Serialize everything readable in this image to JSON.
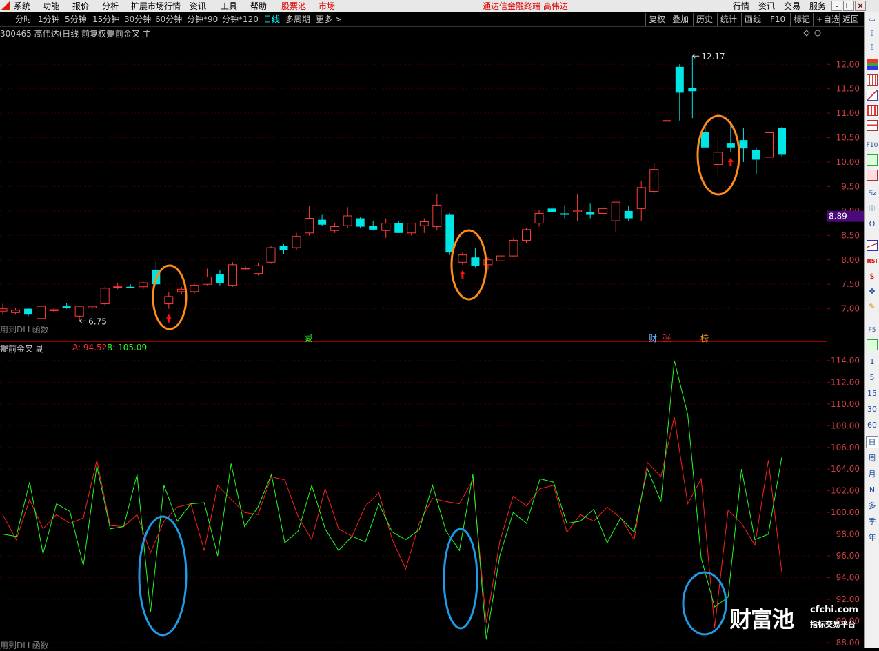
{
  "menu": {
    "items": [
      "系统",
      "功能",
      "报价",
      "分析",
      "扩展市场行情",
      "资讯",
      "工具",
      "帮助"
    ],
    "pool_label": "股票池",
    "market_label": "市场",
    "title": "通达信金融终端  高伟达",
    "right_items": [
      "行情",
      "资讯",
      "交易",
      "服务"
    ]
  },
  "periods": {
    "items": [
      "分时",
      "1分钟",
      "5分钟",
      "15分钟",
      "30分钟",
      "60分钟",
      "分钟*90",
      "分钟*120",
      "日线",
      "多周期",
      "更多 >"
    ],
    "active": "日线"
  },
  "tools": [
    "复权",
    "叠加",
    "历史",
    "统计",
    "画线",
    "F10",
    "标记",
    "+自选",
    "返回"
  ],
  "main_chart": {
    "title": "300465 高伟达(日线 前复权)",
    "indicator": "提前金叉 主",
    "dll_note": "用到DLL函数",
    "current_price": "8.89",
    "high_label": "12.17",
    "low_label": "6.75",
    "event_labels": {
      "jian": "减",
      "cai": "财",
      "zhang": "张",
      "bang": "榜"
    },
    "accent_price_bg": "#4a0a7a"
  },
  "sub_chart": {
    "title": "提前金叉 副",
    "a_label": "A: 94.52",
    "b_label": "B: 105.09",
    "dll_note": "用到DLL函数",
    "a_color": "#ff2020",
    "b_color": "#20ff20"
  },
  "watermark": {
    "brand": "财富池",
    "site": "cfchi.com",
    "tagline": "指标交易平台"
  },
  "right_toolbar": {
    "periods": [
      "1",
      "5",
      "15",
      "30",
      "60",
      "日",
      "周",
      "月",
      "N",
      "多",
      "季",
      "年"
    ],
    "selected": "日",
    "labels": {
      "rsi": "RSI",
      "f5": "F5"
    }
  },
  "chart_data": [
    {
      "type": "candlestick",
      "title": "300465 高伟达(日线 前复权)",
      "ylim": [
        6.6,
        12.3
      ],
      "yticks": [
        7.0,
        7.5,
        8.0,
        8.5,
        9.0,
        9.5,
        10.0,
        10.5,
        11.0,
        11.5,
        12.0
      ],
      "ohlc": [
        [
          6.95,
          7.1,
          6.88,
          7.0
        ],
        [
          6.92,
          7.02,
          6.88,
          6.97
        ],
        [
          7.0,
          7.02,
          6.85,
          6.88
        ],
        [
          6.8,
          7.08,
          6.78,
          7.05
        ],
        [
          6.96,
          7.02,
          6.93,
          6.98
        ],
        [
          7.05,
          7.12,
          7.0,
          7.02
        ],
        [
          6.85,
          7.05,
          6.75,
          7.05
        ],
        [
          7.02,
          7.08,
          6.98,
          7.05
        ],
        [
          7.1,
          7.45,
          7.05,
          7.42
        ],
        [
          7.45,
          7.53,
          7.4,
          7.45
        ],
        [
          7.45,
          7.5,
          7.42,
          7.43
        ],
        [
          7.45,
          7.57,
          7.4,
          7.53
        ],
        [
          7.8,
          7.97,
          7.45,
          7.5
        ],
        [
          7.1,
          7.35,
          7.0,
          7.25
        ],
        [
          7.35,
          7.45,
          7.3,
          7.4
        ],
        [
          7.35,
          7.52,
          7.3,
          7.48
        ],
        [
          7.5,
          7.82,
          7.48,
          7.65
        ],
        [
          7.7,
          7.8,
          7.48,
          7.52
        ],
        [
          7.48,
          7.95,
          7.45,
          7.9
        ],
        [
          7.83,
          7.87,
          7.79,
          7.83
        ],
        [
          7.72,
          7.93,
          7.68,
          7.88
        ],
        [
          7.95,
          8.28,
          7.92,
          8.25
        ],
        [
          8.28,
          8.32,
          8.12,
          8.2
        ],
        [
          8.25,
          8.55,
          8.2,
          8.48
        ],
        [
          8.55,
          9.1,
          8.5,
          8.85
        ],
        [
          8.82,
          8.92,
          8.7,
          8.72
        ],
        [
          8.6,
          8.75,
          8.55,
          8.68
        ],
        [
          8.7,
          9.08,
          8.65,
          8.9
        ],
        [
          8.85,
          8.88,
          8.65,
          8.68
        ],
        [
          8.7,
          8.8,
          8.6,
          8.62
        ],
        [
          8.6,
          8.85,
          8.45,
          8.75
        ],
        [
          8.75,
          8.8,
          8.55,
          8.55
        ],
        [
          8.55,
          8.75,
          8.5,
          8.75
        ],
        [
          8.7,
          8.85,
          8.55,
          8.78
        ],
        [
          8.68,
          9.35,
          8.6,
          9.12
        ],
        [
          8.92,
          8.95,
          8.1,
          8.15
        ],
        [
          7.95,
          8.15,
          7.9,
          8.1
        ],
        [
          8.05,
          8.25,
          7.85,
          7.88
        ],
        [
          7.9,
          8.05,
          7.8,
          8.0
        ],
        [
          7.98,
          8.15,
          7.95,
          8.08
        ],
        [
          8.08,
          8.45,
          8.05,
          8.4
        ],
        [
          8.4,
          8.65,
          8.35,
          8.62
        ],
        [
          8.75,
          9.02,
          8.68,
          8.95
        ],
        [
          9.05,
          9.15,
          8.9,
          8.98
        ],
        [
          8.95,
          9.12,
          8.85,
          8.92
        ],
        [
          8.98,
          9.35,
          8.8,
          9.0
        ],
        [
          8.98,
          9.15,
          8.85,
          8.92
        ],
        [
          8.95,
          9.1,
          8.88,
          9.05
        ],
        [
          8.8,
          9.18,
          8.58,
          9.18
        ],
        [
          9.0,
          9.1,
          8.8,
          8.85
        ],
        [
          9.05,
          9.62,
          8.8,
          9.48
        ],
        [
          9.4,
          9.98,
          9.35,
          9.85
        ],
        [
          10.85,
          10.88,
          10.85,
          10.85
        ],
        [
          11.95,
          12.0,
          10.85,
          11.42
        ],
        [
          11.52,
          12.17,
          10.9,
          11.45
        ],
        [
          10.62,
          10.8,
          10.3,
          10.3
        ],
        [
          9.95,
          10.45,
          9.7,
          10.2
        ],
        [
          10.38,
          10.8,
          10.2,
          10.3
        ],
        [
          10.45,
          10.7,
          10.0,
          10.28
        ],
        [
          10.25,
          10.3,
          9.75,
          10.05
        ],
        [
          10.1,
          10.65,
          10.05,
          10.6
        ],
        [
          10.7,
          10.72,
          10.12,
          10.15
        ]
      ],
      "hline": 8.89
    },
    {
      "type": "line",
      "title": "提前金叉 副",
      "ylim": [
        88.0,
        114.5
      ],
      "yticks": [
        88,
        90,
        92,
        94,
        96,
        98,
        100,
        102,
        104,
        106,
        108,
        110,
        112,
        114
      ],
      "series": [
        {
          "name": "A",
          "color": "#ff2020",
          "values": [
            99.8,
            97.5,
            101.2,
            98.5,
            99.8,
            99.0,
            99.5,
            104.8,
            98.8,
            98.7,
            99.8,
            96.3,
            99.2,
            100.5,
            100.8,
            96.5,
            102.5,
            101.2,
            100.0,
            99.8,
            103.3,
            103.0,
            99.6,
            97.5,
            102.2,
            98.5,
            97.8,
            100.6,
            101.8,
            97.5,
            94.8,
            99.0,
            101.3,
            101.0,
            100.8,
            103.0,
            89.8,
            97.3,
            101.5,
            100.6,
            102.2,
            102.5,
            98.2,
            99.8,
            99.2,
            100.5,
            99.5,
            97.5,
            104.6,
            103.3,
            108.8,
            100.8,
            103.1,
            89.4,
            100.2,
            99.0,
            97.0,
            104.8,
            94.5
          ]
        },
        {
          "name": "B",
          "color": "#20ff20",
          "values": [
            98.0,
            97.8,
            102.8,
            96.2,
            100.8,
            100.1,
            95.1,
            104.3,
            98.5,
            98.7,
            103.5,
            90.8,
            102.5,
            99.2,
            100.8,
            100.9,
            96.0,
            104.5,
            98.7,
            100.5,
            103.5,
            97.2,
            98.3,
            102.5,
            98.5,
            96.5,
            97.8,
            97.3,
            100.8,
            98.2,
            97.5,
            98.4,
            102.5,
            98.3,
            96.5,
            103.5,
            88.3,
            96.0,
            100.0,
            99.0,
            103.1,
            102.8,
            99.0,
            99.2,
            100.3,
            97.2,
            99.5,
            98.2,
            104.0,
            101.0,
            114.0,
            109.0,
            95.8,
            91.3,
            92.2,
            104.0,
            97.5,
            98.0,
            105.1
          ]
        }
      ]
    }
  ]
}
